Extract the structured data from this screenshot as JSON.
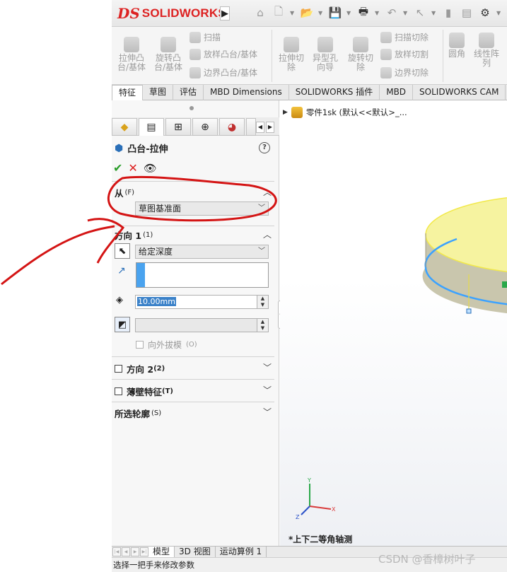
{
  "app": {
    "brand_prefix": "DS",
    "brand": "SOLIDWORKS",
    "expand_arrow": "▶"
  },
  "quick_access": {
    "icons": [
      "home-icon",
      "new-document-icon",
      "open-icon",
      "save-icon",
      "print-icon",
      "undo-icon",
      "select-icon",
      "rebuild-icon",
      "options-icon"
    ]
  },
  "ribbon": {
    "extrude_boss": "拉伸凸\n台/基体",
    "revolve_boss": "旋转凸\n台/基体",
    "sweep": "扫描",
    "loft_boss": "放样凸台/基体",
    "boundary_boss": "边界凸台/基体",
    "extrude_cut": "拉伸切\n除",
    "hole_wizard": "异型孔\n向导",
    "revolve_cut": "旋转切\n除",
    "swept_cut": "扫描切除",
    "lofted_cut": "放样切割",
    "boundary_cut": "边界切除",
    "fillet": "圆角",
    "linear_pattern": "线性阵\n列"
  },
  "command_tabs": [
    "特征",
    "草图",
    "评估",
    "MBD Dimensions",
    "SOLIDWORKS 插件",
    "MBD",
    "SOLIDWORKS CAM"
  ],
  "property_manager": {
    "title": "凸台-拉伸",
    "help": "?",
    "ok_symbol": "✔",
    "cancel_symbol": "✕",
    "preview_symbol": "👁",
    "from_section": {
      "label": "从",
      "shortcut": "(F)",
      "start_condition": "草图基准面"
    },
    "direction1": {
      "label": "方向 1",
      "shortcut": "(1)",
      "end_condition": "给定深度",
      "depth": "10.00mm",
      "draft_outward_label": "向外拔模",
      "draft_outward_shortcut": "(O)"
    },
    "direction2": {
      "label": "方向 2",
      "shortcut": "(2)"
    },
    "thin_feature": {
      "label": "薄壁特征",
      "shortcut": "(T)"
    },
    "selected_contours": {
      "label": "所选轮廓",
      "shortcut": "(S)"
    }
  },
  "viewport": {
    "tree_item": "零件1sk  (默认<<默认>_...",
    "view_label": "*上下二等角轴测",
    "triad": {
      "x": "X",
      "y": "Y",
      "z": "Z"
    }
  },
  "bottom_tabs": [
    "模型",
    "3D 视图",
    "运动算例 1"
  ],
  "status": "选择一把手来修改参数",
  "watermark": "CSDN @香樟树叶子",
  "colors": {
    "brand_red": "#d22222",
    "annotation_red": "#d41414",
    "extrude_top_yellow": "#f5f08a",
    "extrude_edge_blue": "#3ba2ff",
    "ok_green": "#2a9d2a"
  }
}
